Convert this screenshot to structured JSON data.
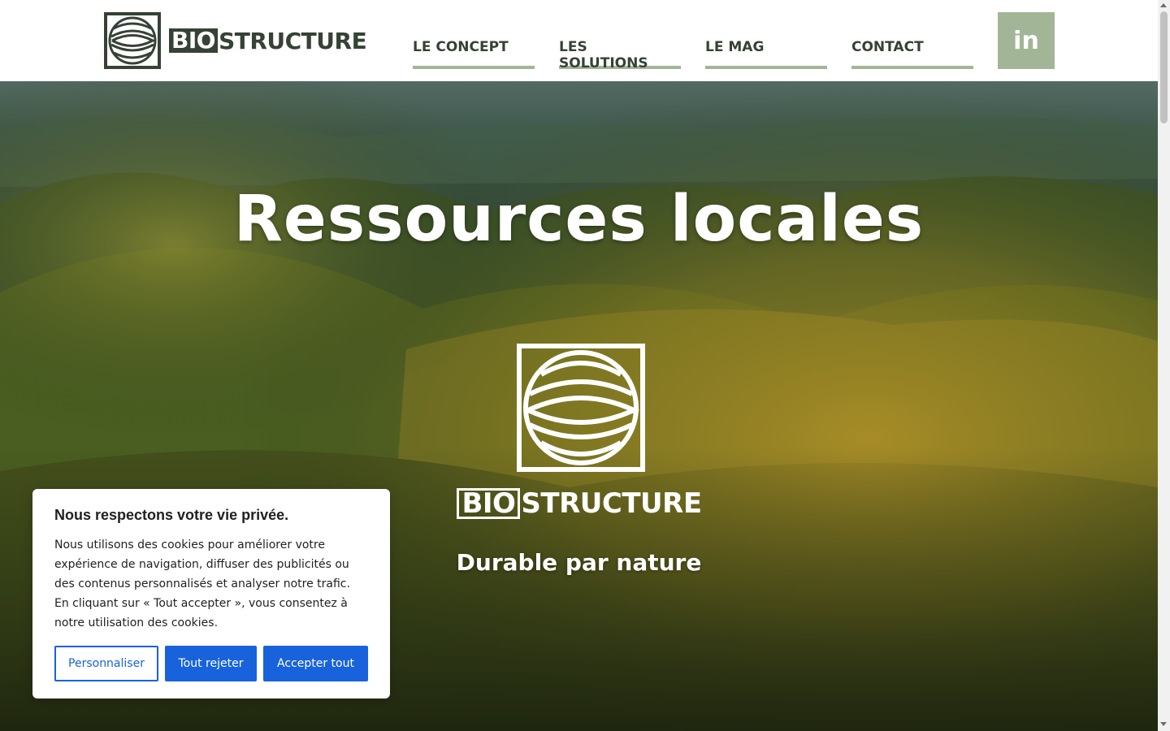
{
  "header": {
    "logo": {
      "bio": "BIO",
      "rest": "STRUCTURE",
      "icon": "biostructure-logo-icon"
    },
    "nav": [
      {
        "label": "LE CONCEPT"
      },
      {
        "label": "LES SOLUTIONS"
      },
      {
        "label": "LE MAG"
      },
      {
        "label": "CONTACT"
      }
    ],
    "social": {
      "label": "in",
      "icon": "linkedin-icon"
    }
  },
  "hero": {
    "title": "Ressources locales",
    "logo": {
      "bio": "BIO",
      "rest": "STRUCTURE"
    },
    "tagline": "Durable par nature"
  },
  "cookie_banner": {
    "title": "Nous respectons votre vie privée.",
    "text": "Nous utilisons des cookies pour améliorer votre expérience de navigation, diffuser des publicités ou des contenus personnalisés et analyser notre trafic. En cliquant sur « Tout accepter », vous consentez à notre utilisation des cookies.",
    "customize": "Personnaliser",
    "reject": "Tout rejeter",
    "accept": "Accepter tout"
  },
  "colors": {
    "brand_dark": "#354235",
    "brand_sage": "#a3b597",
    "cookie_blue": "#1863dc"
  }
}
